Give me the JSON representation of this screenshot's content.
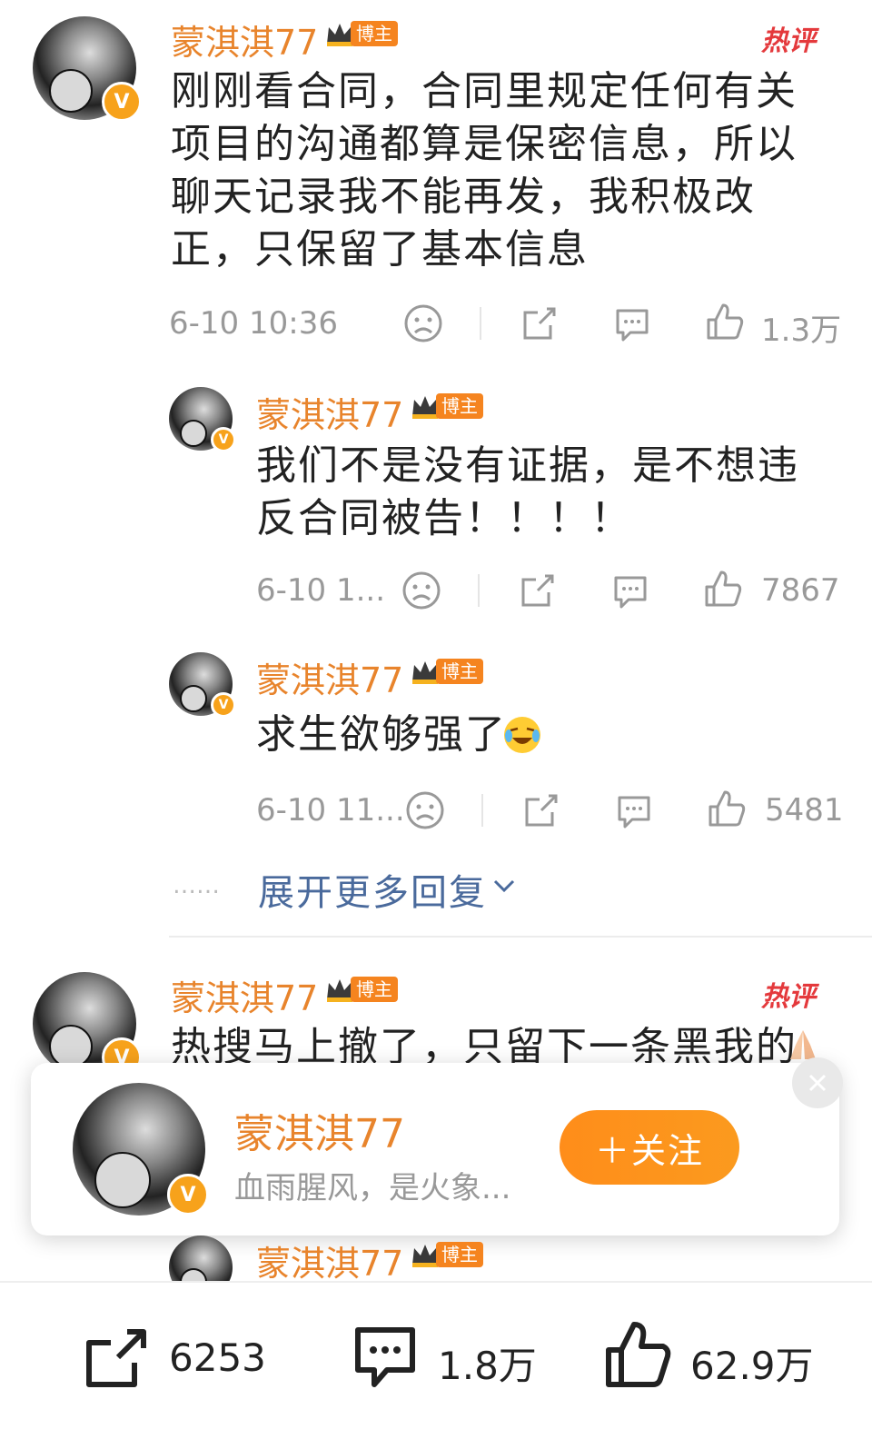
{
  "comments": [
    {
      "user": "蒙淇淇77",
      "role_tag": "博主",
      "hot_label": "热评",
      "text": "刚刚看合同，合同里规定任何有关项目的沟通都算是保密信息，所以聊天记录我不能再发，我积极改正，只保留了基本信息",
      "time": "6-10 10:36",
      "likes": "1.3万",
      "replies": [
        {
          "user": "蒙淇淇77",
          "role_tag": "博主",
          "text": "我们不是没有证据，是不想违反合同被告！！！！",
          "time": "6-10 1...",
          "likes": "7867"
        },
        {
          "user": "蒙淇淇77",
          "role_tag": "博主",
          "text": "求生欲够强了",
          "time": "6-10 11...",
          "likes": "5481"
        }
      ],
      "expand_label": "展开更多回复",
      "expand_dots": "……"
    },
    {
      "user": "蒙淇淇77",
      "role_tag": "博主",
      "hot_label": "热评",
      "text": "热搜马上撤了，只留下一条黑我的",
      "reply_user": "蒙淇淇77",
      "reply_role_tag": "博主"
    }
  ],
  "popup": {
    "name": "蒙淇淇77",
    "bio": "血雨腥风，是火象...",
    "follow_label": "＋关注"
  },
  "bottom_bar": {
    "reposts": "6253",
    "comments": "1.8万",
    "likes": "62.9万"
  },
  "colors": {
    "username": "#e8842c",
    "hot": "#e4393c",
    "accent": "#f5841f",
    "link": "#4a6a9c"
  }
}
